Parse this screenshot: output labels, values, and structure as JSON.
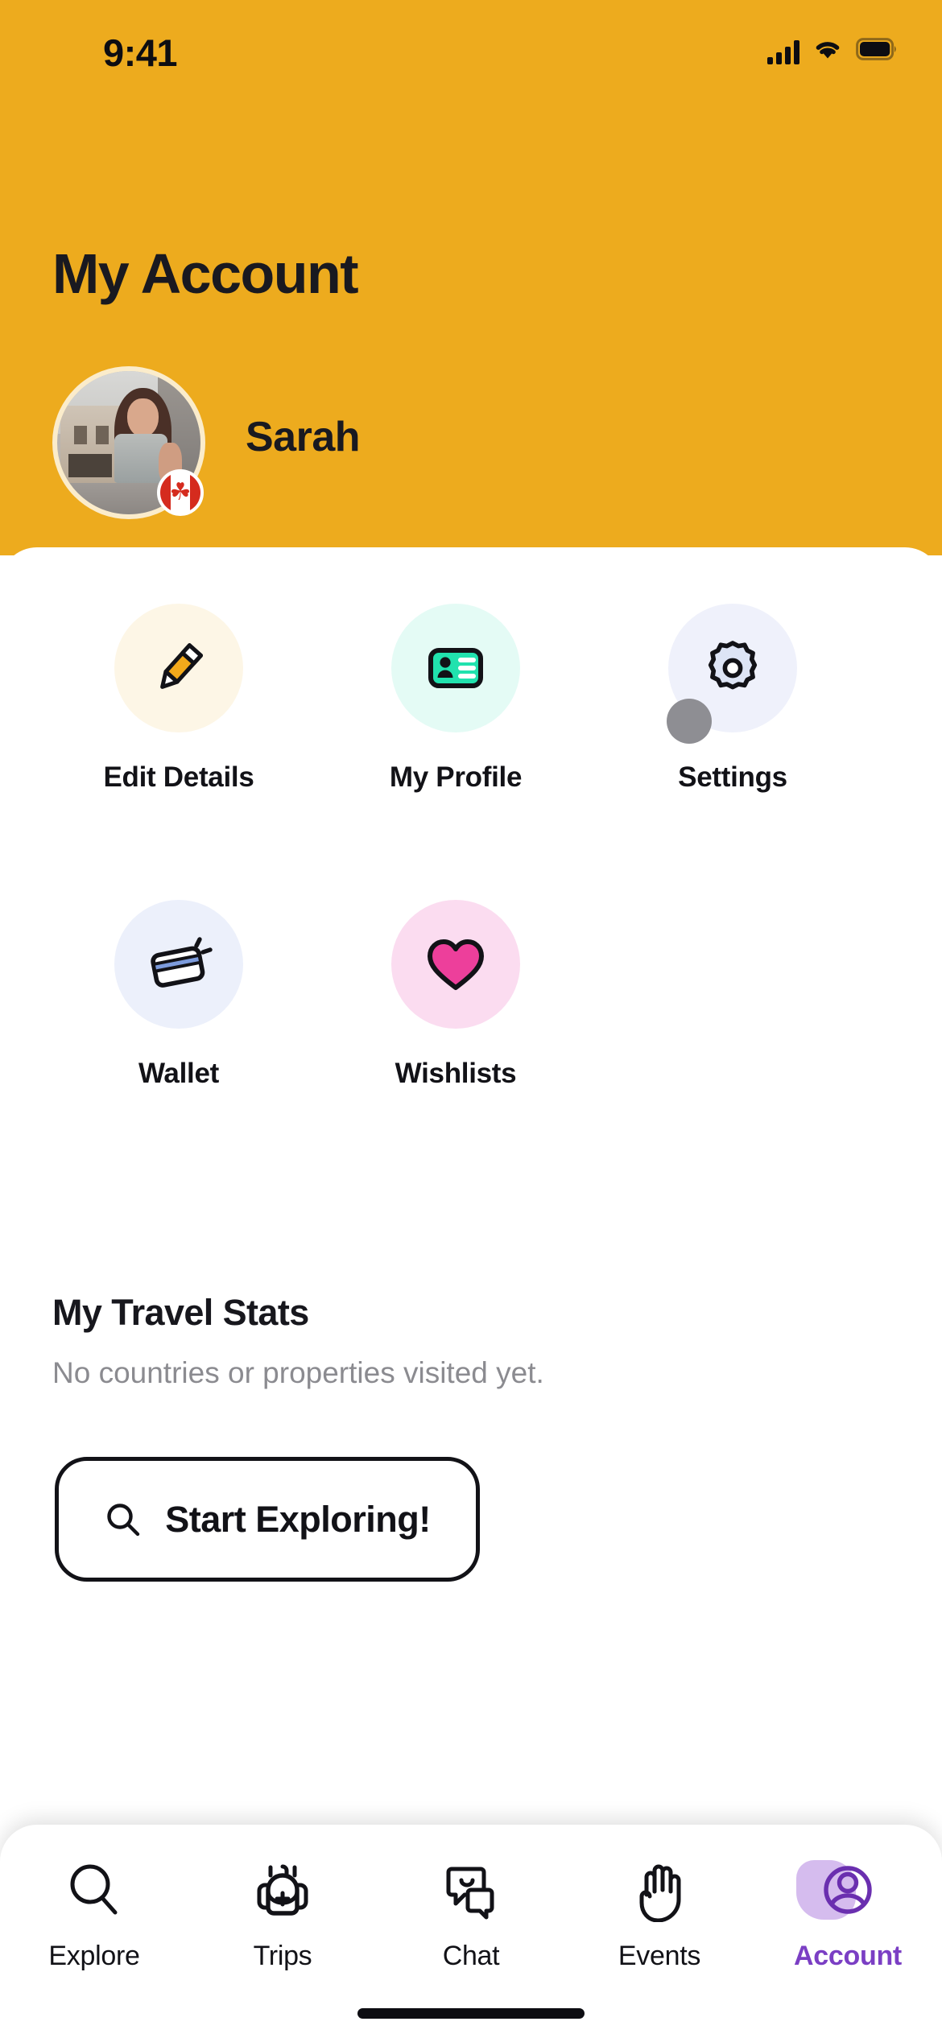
{
  "status_bar": {
    "time": "9:41",
    "signal_icon": "signal-bars-icon",
    "wifi_icon": "wifi-icon",
    "battery_icon": "battery-full-icon"
  },
  "header": {
    "title": "My Account",
    "accent_color": "#EDAB1E",
    "profile": {
      "name": "Sarah",
      "avatar_icon": "avatar-photo",
      "flag_badge": "canada-flag-icon",
      "flag_leaf": "☘"
    }
  },
  "quick_actions": [
    {
      "label": "Edit Details",
      "icon": "pencil-icon",
      "tile_color": "#FDF6E6",
      "icon_color": "#F2A91B"
    },
    {
      "label": "My Profile",
      "icon": "id-card-icon",
      "tile_color": "#E4FBF5",
      "icon_color": "#21E2AE"
    },
    {
      "label": "Settings",
      "icon": "gear-icon",
      "tile_color": "#EFF1FB",
      "icon_color": "#DDE4F5"
    },
    {
      "label": "Wallet",
      "icon": "credit-card-icon",
      "tile_color": "#ECF0FB",
      "icon_color": "#7C9BDC"
    },
    {
      "label": "Wishlists",
      "icon": "heart-icon",
      "tile_color": "#FBDCF0",
      "icon_color": "#ED3F9B"
    }
  ],
  "travel_stats": {
    "title": "My Travel Stats",
    "empty_message": "No countries or properties visited yet."
  },
  "explore_button": {
    "label": "Start Exploring!",
    "icon": "search-icon"
  },
  "tab_bar": {
    "active_color": "#7B3FC4",
    "items": [
      {
        "label": "Explore",
        "icon": "search-icon",
        "active": false
      },
      {
        "label": "Trips",
        "icon": "backpack-icon",
        "active": false
      },
      {
        "label": "Chat",
        "icon": "chat-bubbles-icon",
        "active": false
      },
      {
        "label": "Events",
        "icon": "waving-hand-icon",
        "active": false
      },
      {
        "label": "Account",
        "icon": "user-circle-icon",
        "active": true
      }
    ]
  }
}
